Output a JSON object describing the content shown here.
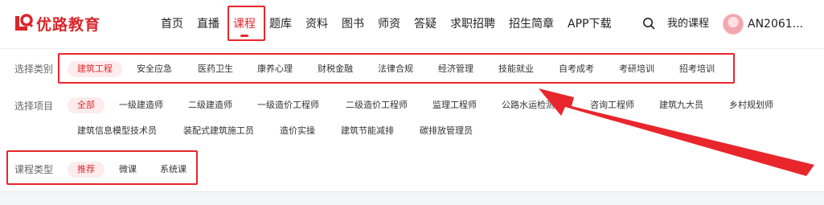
{
  "header": {
    "logo_text": "优路教育",
    "nav": [
      {
        "label": "首页"
      },
      {
        "label": "直播"
      },
      {
        "label": "课程",
        "active": true
      },
      {
        "label": "题库"
      },
      {
        "label": "资料"
      },
      {
        "label": "图书"
      },
      {
        "label": "师资"
      },
      {
        "label": "答疑"
      },
      {
        "label": "求职招聘"
      },
      {
        "label": "招生简章"
      },
      {
        "label": "APP下载"
      }
    ],
    "search_icon": "search-icon",
    "my_courses": "我的课程",
    "user_name": "AN2061..."
  },
  "filters": {
    "category": {
      "label": "选择类别",
      "items": [
        "建筑工程",
        "安全应急",
        "医药卫生",
        "康养心理",
        "财税金融",
        "法律合规",
        "经济管理",
        "技能就业",
        "自考成考",
        "考研培训",
        "招考培训"
      ],
      "active": "建筑工程"
    },
    "project": {
      "label": "选择项目",
      "items_line1": [
        "全部",
        "一级建造师",
        "二级建造师",
        "一级造价工程师",
        "二级造价工程师",
        "监理工程师",
        "公路水运检测师",
        "咨询工程师",
        "建筑九大员",
        "乡村规划师"
      ],
      "items_line2": [
        "建筑信息模型技术员",
        "装配式建筑施工员",
        "造价实操",
        "建筑节能减排",
        "碳排放管理员"
      ],
      "active": "全部"
    },
    "course_type": {
      "label": "课程类型",
      "items": [
        "推荐",
        "微课",
        "系统课"
      ],
      "active": "推荐"
    }
  },
  "colors": {
    "accent": "#e02a2f",
    "annotation": "#e8262c",
    "chip_active_bg": "#fdeced"
  }
}
